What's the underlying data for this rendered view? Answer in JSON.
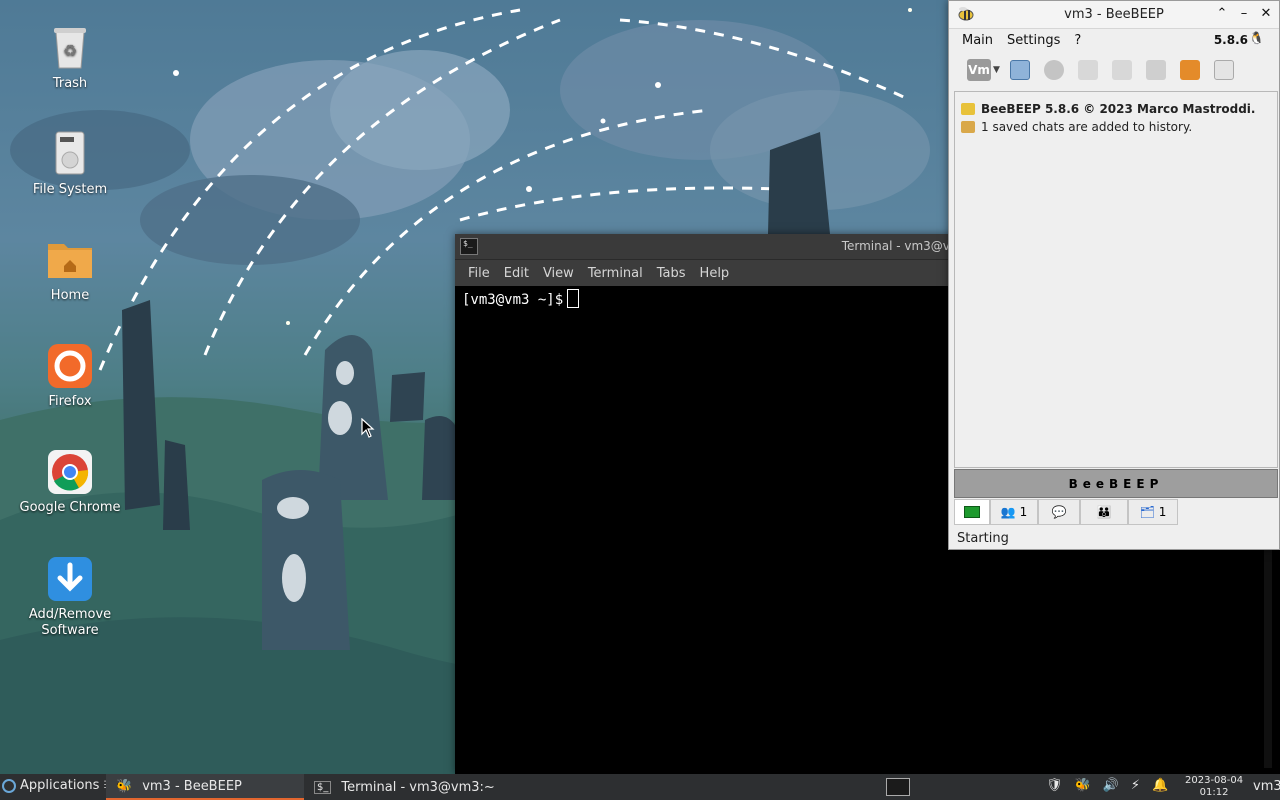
{
  "desktop": {
    "icons": [
      {
        "label": "Trash",
        "icon": "trash-icon"
      },
      {
        "label": "File System",
        "icon": "drive-icon"
      },
      {
        "label": "Home",
        "icon": "home-folder-icon"
      },
      {
        "label": "Firefox",
        "icon": "firefox-icon"
      },
      {
        "label": "Google Chrome",
        "icon": "chrome-icon"
      },
      {
        "label": "Add/Remove Software",
        "icon": "download-icon"
      }
    ]
  },
  "terminal": {
    "title": "Terminal - vm3@vm3:~",
    "menu": [
      "File",
      "Edit",
      "View",
      "Terminal",
      "Tabs",
      "Help"
    ],
    "prompt": "[vm3@vm3 ~]$"
  },
  "beebeep": {
    "title": "vm3 - BeeBEEP",
    "menu": [
      "Main",
      "Settings",
      "?"
    ],
    "version": "5.8.6",
    "toolbar_user": "Vm",
    "log": [
      {
        "text": "BeeBEEP 5.8.6 © 2023 Marco Mastroddi.",
        "bold": true
      },
      {
        "text": "1 saved chats are added to history.",
        "bold": false
      }
    ],
    "brand": "BeeBEEP",
    "tabs": [
      {
        "icon": "computer-icon",
        "count": ""
      },
      {
        "icon": "users-icon",
        "count": "1"
      },
      {
        "icon": "chat-icon",
        "count": ""
      },
      {
        "icon": "groups-icon",
        "count": ""
      },
      {
        "icon": "files-icon",
        "count": "1"
      }
    ],
    "status": "Starting",
    "colors": {
      "log_bg": "#efefef",
      "brand_bar": "#9e9e9e"
    }
  },
  "taskbar": {
    "applications": "Applications",
    "tasks": [
      {
        "label": "vm3 - BeeBEEP",
        "active": true
      },
      {
        "label": "Terminal - vm3@vm3:~",
        "active": false
      }
    ],
    "date": "2023-08-04",
    "time": "01:12",
    "user": "vm3",
    "accent": "#e2662f"
  }
}
